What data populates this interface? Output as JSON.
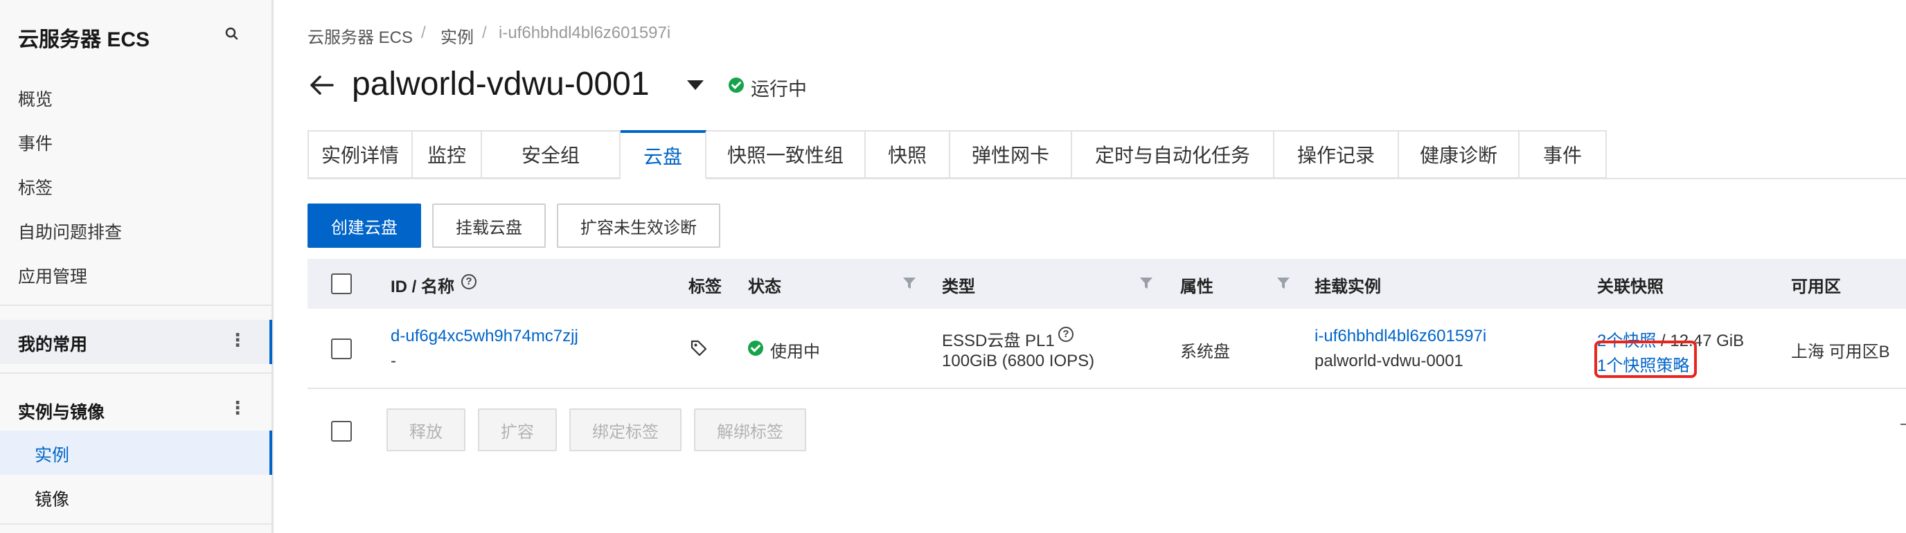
{
  "sidebar": {
    "title": "云服务器 ECS",
    "items": [
      "概览",
      "事件",
      "标签",
      "自助问题排查",
      "应用管理"
    ],
    "favorites": "我的常用",
    "group": "实例与镜像",
    "sub_items": [
      "实例",
      "镜像"
    ],
    "more_glyph": "⋮"
  },
  "breadcrumb": {
    "items": [
      "云服务器 ECS",
      "实例",
      "i-uf6hbhdl4bl6z601597i"
    ],
    "separator": "/"
  },
  "header": {
    "title": "palworld-vdwu-0001",
    "status": "运行中"
  },
  "tabs": [
    "实例详情",
    "监控",
    "安全组",
    "云盘",
    "快照一致性组",
    "快照",
    "弹性网卡",
    "定时与自动化任务",
    "操作记录",
    "健康诊断",
    "事件"
  ],
  "active_tab": "云盘",
  "toolbar": {
    "create": "创建云盘",
    "attach": "挂载云盘",
    "diagnose": "扩容未生效诊断"
  },
  "table": {
    "columns": {
      "id": "ID / 名称",
      "tag": "标签",
      "status": "状态",
      "type": "类型",
      "attr": "属性",
      "instance": "挂载实例",
      "snapshot": "关联快照",
      "zone": "可用区"
    },
    "help_glyph": "?",
    "rows": [
      {
        "id": "d-uf6g4xc5wh9h74mc7zjj",
        "name": "-",
        "status": "使用中",
        "type": "ESSD云盘 PL1",
        "spec": "100GiB (6800 IOPS)",
        "attr": "系统盘",
        "instance_id": "i-uf6hbhdl4bl6z601597i",
        "instance_name": "palworld-vdwu-0001",
        "snapshot_count": "2个快照",
        "snapshot_size": " / 12.47 GiB",
        "snapshot_policy": "1个快照策略",
        "zone": "上海 可用区B"
      }
    ]
  },
  "batch": {
    "release": "释放",
    "expand": "扩容",
    "bind_tag": "绑定标签",
    "unbind_tag": "解绑标签"
  },
  "colors": {
    "accent": "#0064c8",
    "status_ok": "#17a34a",
    "highlight": "#e8251c"
  }
}
